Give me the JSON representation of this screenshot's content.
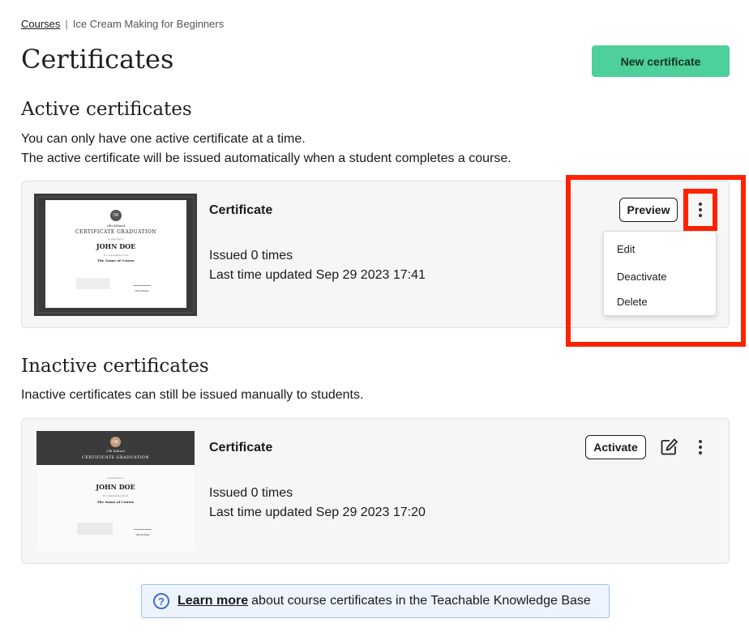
{
  "breadcrumb": {
    "courses": "Courses",
    "separator": "|",
    "course": "Ice Cream Making for Beginners"
  },
  "page_title": "Certificates",
  "new_certificate_label": "New certificate",
  "active": {
    "title": "Active certificates",
    "desc_line1": "You can only have one active certificate at a time.",
    "desc_line2": "The active certificate will be issued automatically when a student completes a course.",
    "card": {
      "name": "Certificate",
      "issued": "Issued 0 times",
      "updated": "Last time updated Sep 29 2023 17:41",
      "preview_label": "Preview",
      "menu": {
        "edit": "Edit",
        "deactivate": "Deactivate",
        "delete": "Delete"
      }
    }
  },
  "inactive": {
    "title": "Inactive certificates",
    "desc": "Inactive certificates can still be issued manually to students.",
    "card": {
      "name": "Certificate",
      "issued": "Issued 0 times",
      "updated": "Last time updated Sep 29 2023 17:20",
      "activate_label": "Activate"
    }
  },
  "thumb": {
    "initials": "OK",
    "school": "Olli Köhnel",
    "heading": "CERTIFICATE GRADUATION",
    "awarded": "is awarded to",
    "student": "JOHN DOE",
    "for_text": "For graduating from",
    "course": "The Name of Course",
    "signer": "Olli Köhnel"
  },
  "learn_more": {
    "link": "Learn more",
    "text": "about course certificates in the Teachable Knowledge Base"
  },
  "colors": {
    "accent": "#4dd09a",
    "highlight": "#ff2200"
  }
}
